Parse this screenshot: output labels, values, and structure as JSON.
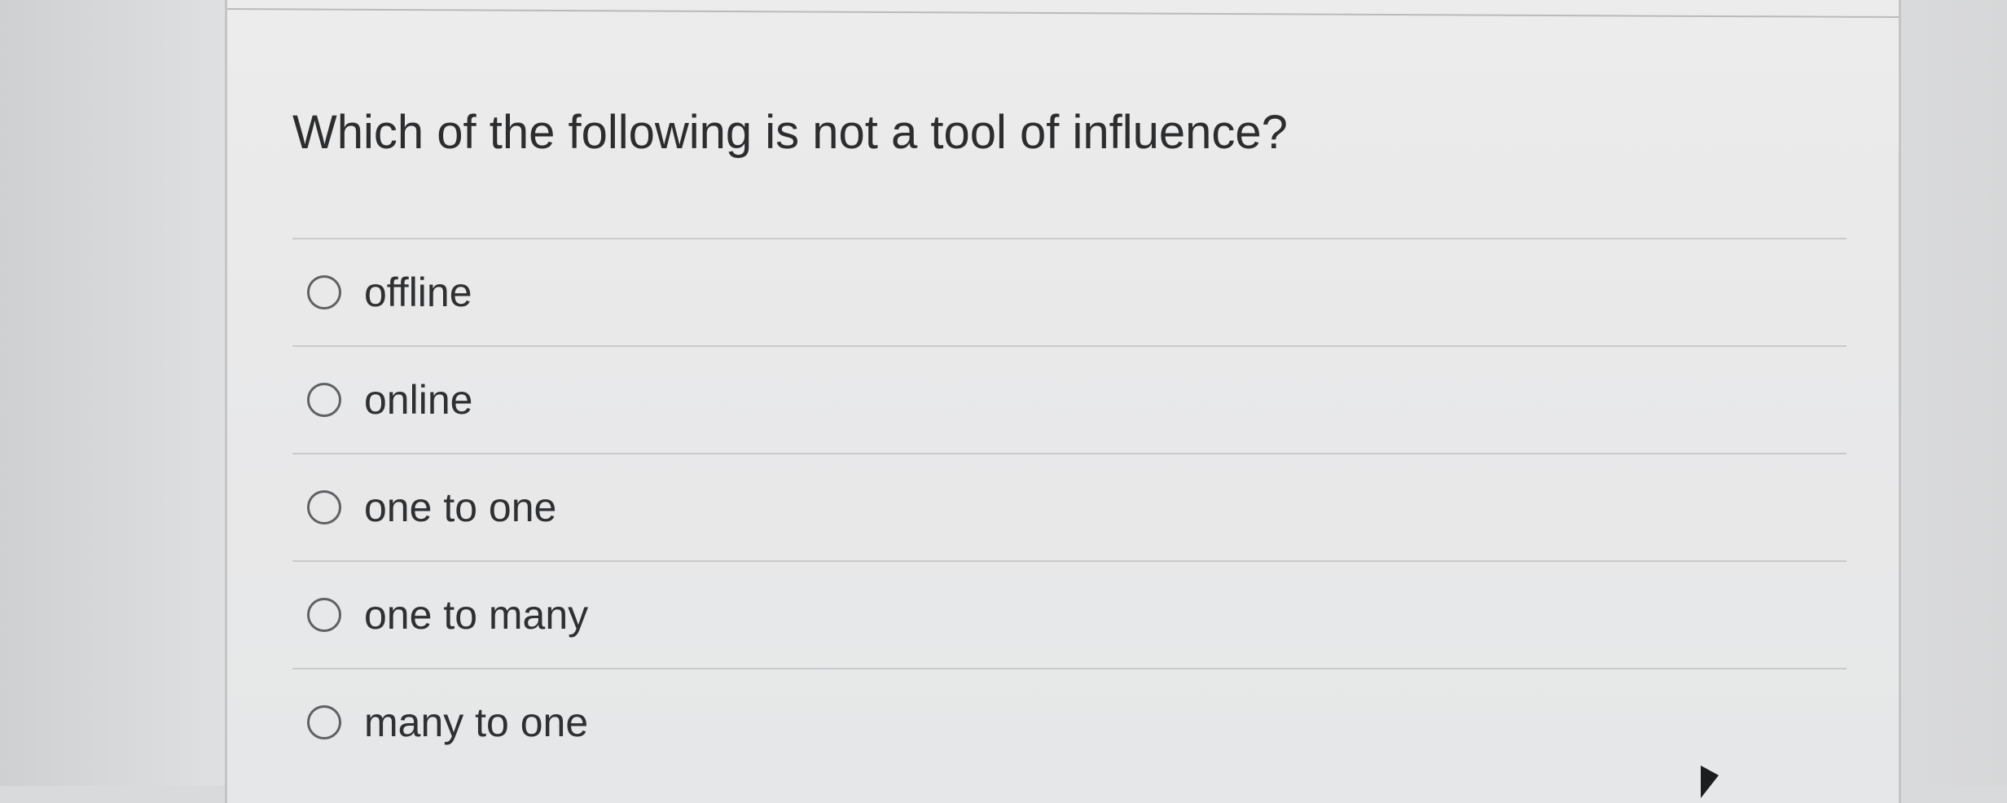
{
  "question": {
    "text": "Which of the following is not a tool of influence?"
  },
  "options": [
    {
      "label": "offline"
    },
    {
      "label": "online"
    },
    {
      "label": "one to one"
    },
    {
      "label": "one to many"
    },
    {
      "label": "many to one"
    }
  ]
}
